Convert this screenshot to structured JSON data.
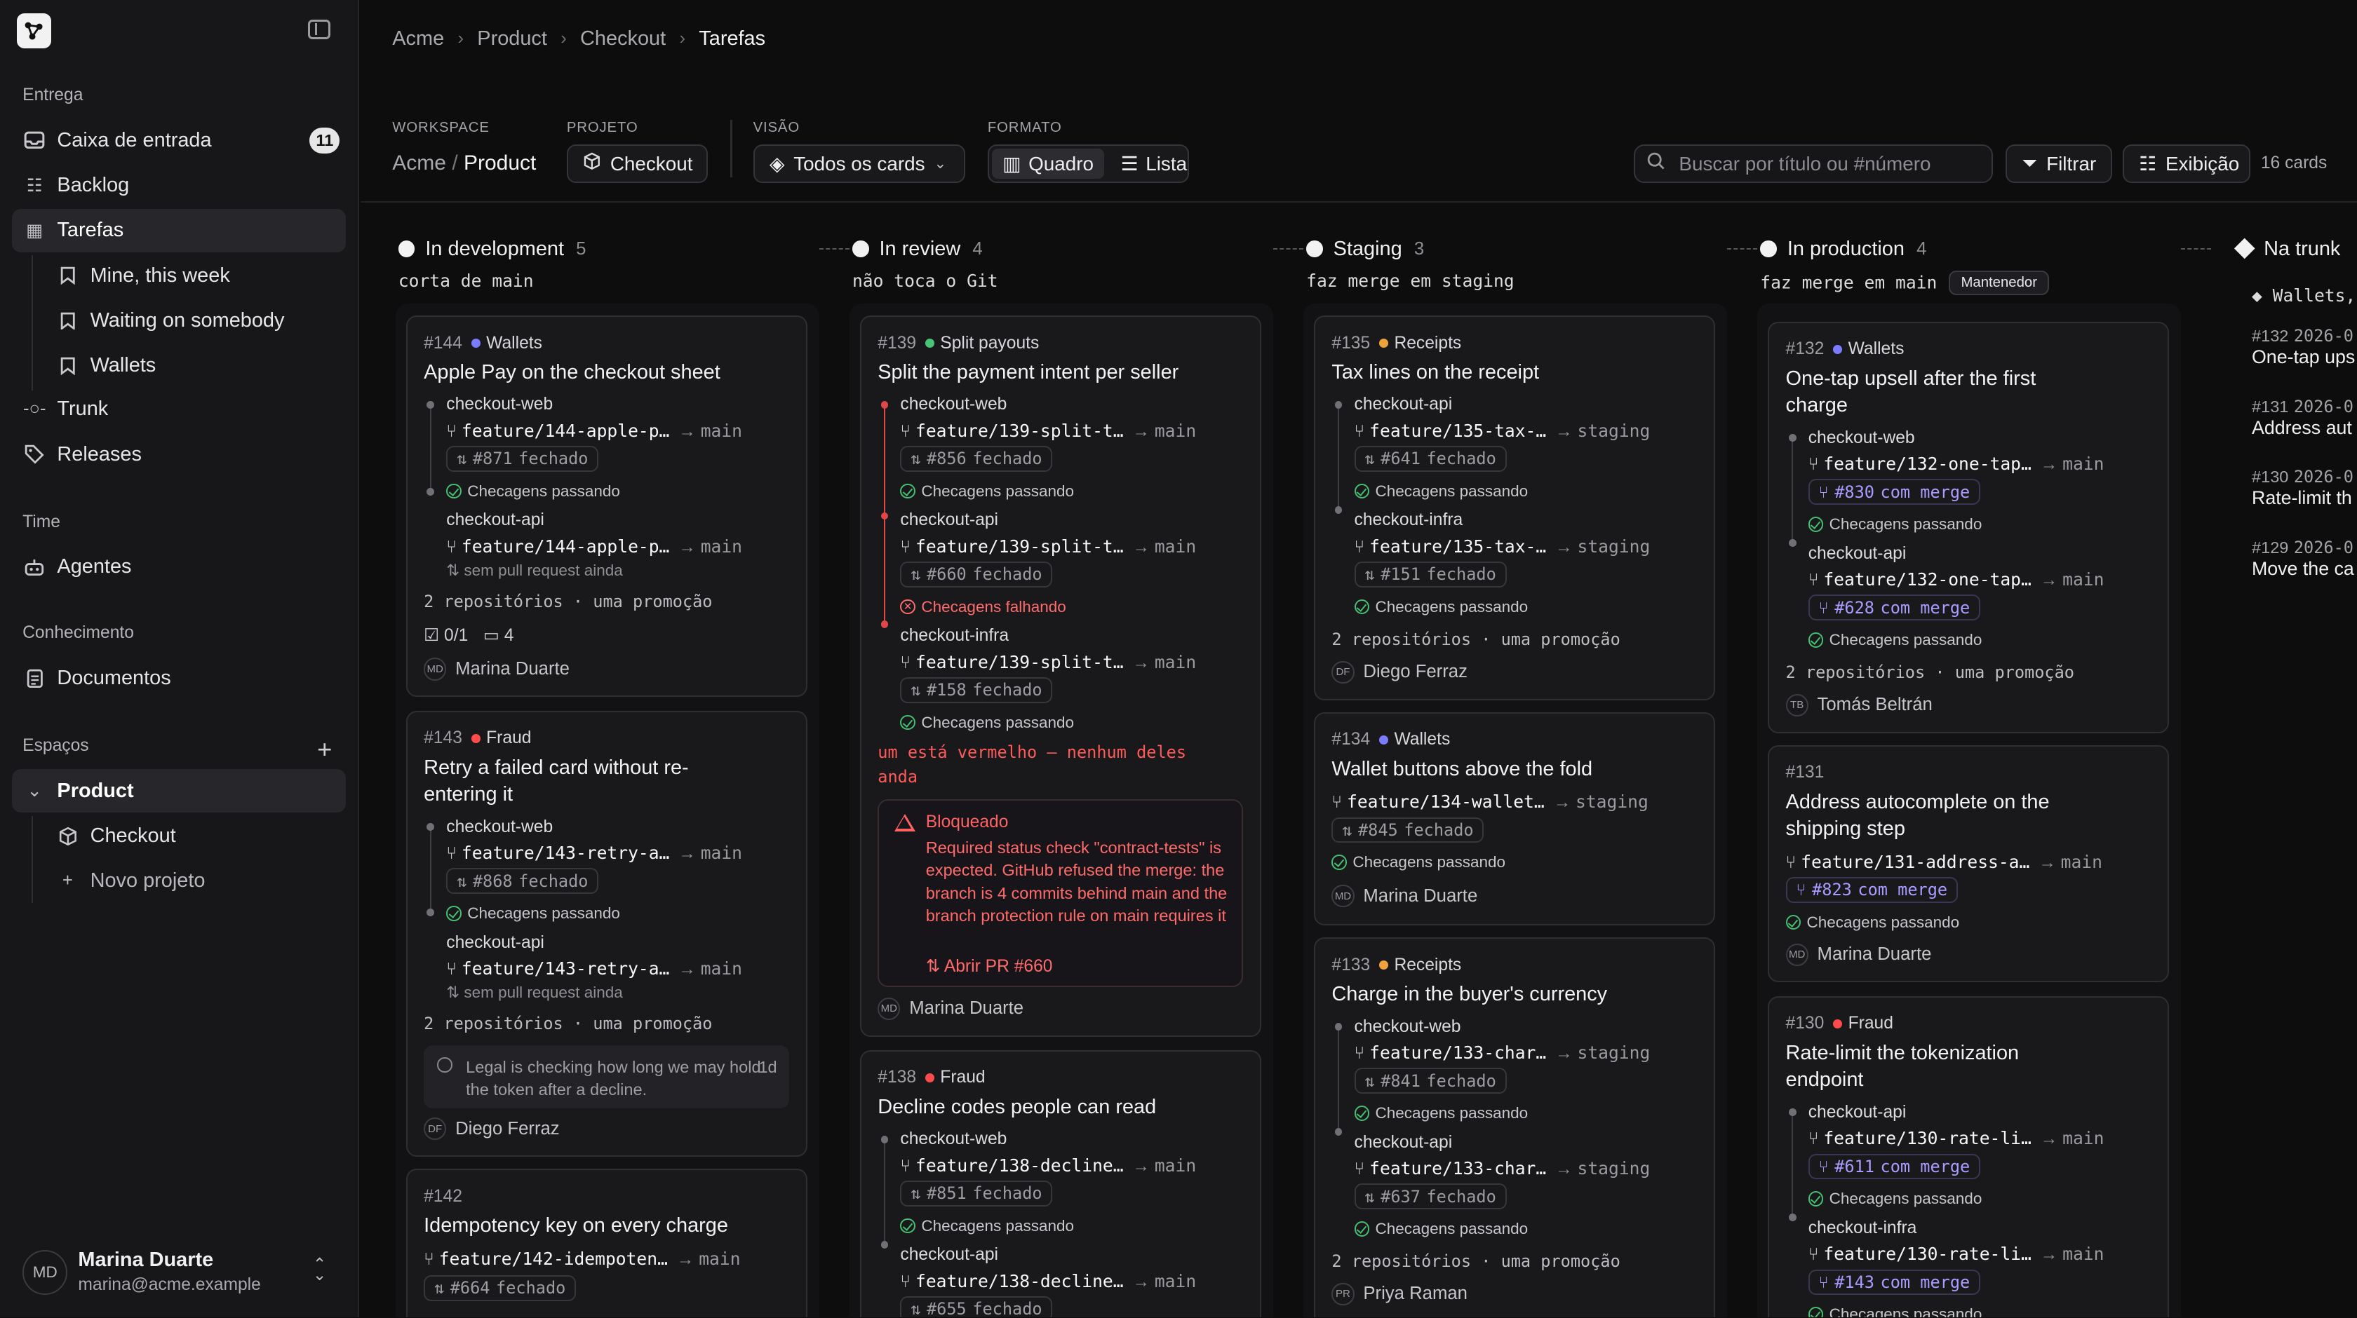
{
  "breadcrumbs": [
    "Acme",
    "Product",
    "Checkout",
    "Tarefas"
  ],
  "sidebar": {
    "groups": {
      "entrega": "Entrega",
      "time": "Time",
      "conhecimento": "Conhecimento",
      "espacos": "Espaços"
    },
    "inbox": {
      "label": "Caixa de entrada",
      "count": "11"
    },
    "backlog": "Backlog",
    "tarefas": "Tarefas",
    "views": [
      "Mine, this week",
      "Waiting on somebody",
      "Wallets"
    ],
    "trunk": "Trunk",
    "releases": "Releases",
    "agentes": "Agentes",
    "documentos": "Documentos",
    "product": "Product",
    "checkout": "Checkout",
    "novo": "Novo projeto",
    "user": {
      "initials": "MD",
      "name": "Marina Duarte",
      "email": "marina@acme.example"
    }
  },
  "filters": {
    "workspace_label": "WORKSPACE",
    "projeto_label": "PROJETO",
    "visao_label": "VISÃO",
    "formato_label": "FORMATO",
    "ws_org": "Acme",
    "ws_sep": "/",
    "ws_name": "Product",
    "projeto": "Checkout",
    "visao": "Todos os cards",
    "quadro": "Quadro",
    "lista": "Lista",
    "search_placeholder": "Buscar por título ou #número",
    "filtrar": "Filtrar",
    "exibicao": "Exibição",
    "count": "16 cards"
  },
  "columns": [
    {
      "name": "In development",
      "count": "5",
      "subtitle": "corta de main"
    },
    {
      "name": "In review",
      "count": "4",
      "subtitle": "não toca o Git"
    },
    {
      "name": "Staging",
      "count": "3",
      "subtitle": "faz merge em staging"
    },
    {
      "name": "In production",
      "count": "4",
      "subtitle": "faz merge em main",
      "badge": "Mantenedor"
    },
    {
      "name": "Na trunk",
      "subtitle": "Wallets,"
    }
  ],
  "colors": {
    "wallets": "#7b7bff",
    "splitpayouts": "#47c476",
    "receipts": "#f0a23a",
    "fraud": "#ff4b4b",
    "green": "#45c071",
    "red": "#e04848",
    "merged": "#a99cff"
  },
  "text": {
    "fechado": "fechado",
    "merge": "com merge",
    "pass": "Checagens passando",
    "fail": "Checagens falhando",
    "nopr": "sem pull request ainda",
    "dois": "2 repositórios · uma promoção",
    "arrow": "→"
  },
  "cards": {
    "c144": {
      "num": "#144",
      "tag": "Wallets",
      "title": "Apple Pay on the checkout sheet",
      "r1": "checkout-web",
      "b1": "feature/144-apple-p…",
      "t1": "main",
      "p1": "#871",
      "r2": "checkout-api",
      "b2": "feature/144-apple-p…",
      "t2": "main",
      "stats_chk": "0/1",
      "stats_cmt": "4",
      "oi": "MD",
      "owner": "Marina Duarte"
    },
    "c143": {
      "num": "#143",
      "tag": "Fraud",
      "title": "Retry a failed card without re-entering it",
      "r1": "checkout-web",
      "b1": "feature/143-retry-a…",
      "t1": "main",
      "p1": "#868",
      "r2": "checkout-api",
      "b2": "feature/143-retry-a…",
      "t2": "main",
      "note": "Legal is checking how long we may hold the token after a decline.",
      "ago": "1d",
      "oi": "DF",
      "owner": "Diego Ferraz"
    },
    "c142": {
      "num": "#142",
      "title": "Idempotency key on every charge",
      "b1": "feature/142-idempoten…",
      "t1": "main",
      "p1": "#664"
    },
    "c139": {
      "num": "#139",
      "tag": "Split payouts",
      "title": "Split the payment intent per seller",
      "r1": "checkout-web",
      "b1": "feature/139-split-t…",
      "t1": "main",
      "p1": "#856",
      "r2": "checkout-api",
      "b2": "feature/139-split-t…",
      "t2": "main",
      "p2": "#660",
      "r3": "checkout-infra",
      "b3": "feature/139-split-t…",
      "t3": "main",
      "p3": "#158",
      "warn": "um está vermelho — nenhum deles anda",
      "bt": "Bloqueado",
      "bd": "Required status check \"contract-tests\" is expected. GitHub refused the merge: the branch is 4 commits behind main and the branch protection rule on main requires it to be up to date.",
      "bl": "Abrir PR #660",
      "oi": "MD",
      "owner": "Marina Duarte"
    },
    "c138": {
      "num": "#138",
      "tag": "Fraud",
      "title": "Decline codes people can read",
      "r1": "checkout-web",
      "b1": "feature/138-decline…",
      "t1": "main",
      "p1": "#851",
      "r2": "checkout-api",
      "b2": "feature/138-decline…",
      "t2": "main",
      "p2": "#655"
    },
    "c135": {
      "num": "#135",
      "tag": "Receipts",
      "title": "Tax lines on the receipt",
      "r1": "checkout-api",
      "b1": "feature/135-tax-…",
      "t1": "staging",
      "p1": "#641",
      "r2": "checkout-infra",
      "b2": "feature/135-tax-…",
      "t2": "staging",
      "p2": "#151",
      "oi": "DF",
      "owner": "Diego Ferraz"
    },
    "c134": {
      "num": "#134",
      "tag": "Wallets",
      "title": "Wallet buttons above the fold",
      "b1": "feature/134-wallet…",
      "t1": "staging",
      "p1": "#845",
      "oi": "MD",
      "owner": "Marina Duarte"
    },
    "c133": {
      "num": "#133",
      "tag": "Receipts",
      "title": "Charge in the buyer's currency",
      "r1": "checkout-web",
      "b1": "feature/133-char…",
      "t1": "staging",
      "p1": "#841",
      "r2": "checkout-api",
      "b2": "feature/133-char…",
      "t2": "staging",
      "p2": "#637",
      "oi": "PR",
      "owner": "Priya Raman"
    },
    "c132": {
      "num": "#132",
      "tag": "Wallets",
      "title": "One-tap upsell after the first charge",
      "r1": "checkout-web",
      "b1": "feature/132-one-tap…",
      "t1": "main",
      "p1": "#830",
      "r2": "checkout-api",
      "b2": "feature/132-one-tap…",
      "t2": "main",
      "p2": "#628",
      "oi": "TB",
      "owner": "Tomás Beltrán"
    },
    "c131": {
      "num": "#131",
      "title": "Address autocomplete on the shipping step",
      "b1": "feature/131-address-a…",
      "t1": "main",
      "p1": "#823",
      "oi": "MD",
      "owner": "Marina Duarte"
    },
    "c130": {
      "num": "#130",
      "tag": "Fraud",
      "title": "Rate-limit the tokenization endpoint",
      "r1": "checkout-api",
      "b1": "feature/130-rate-li…",
      "t1": "main",
      "p1": "#611",
      "r2": "checkout-infra",
      "b2": "feature/130-rate-li…",
      "t2": "main",
      "p2": "#143"
    }
  },
  "trunk": [
    {
      "num": "#132",
      "date": "2026-0",
      "title": "One-tap ups"
    },
    {
      "num": "#131",
      "date": "2026-0",
      "title": "Address aut"
    },
    {
      "num": "#130",
      "date": "2026-0",
      "title": "Rate-limit th"
    },
    {
      "num": "#129",
      "date": "2026-0",
      "title": "Move the ca"
    }
  ]
}
